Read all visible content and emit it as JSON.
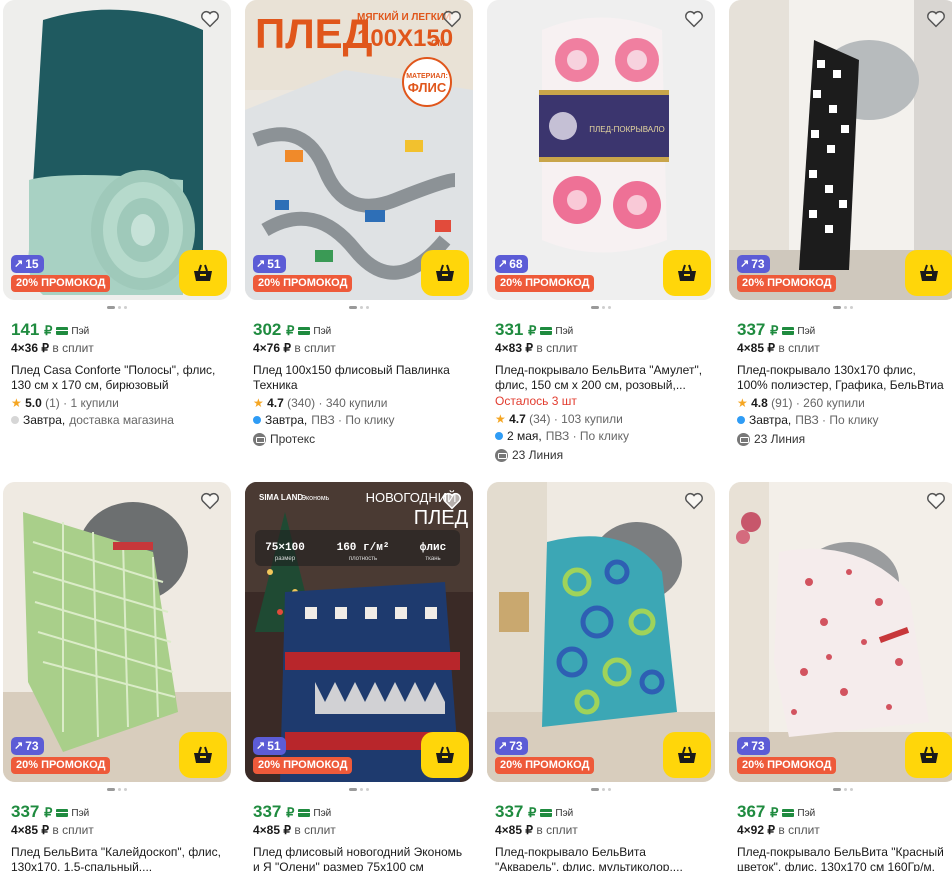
{
  "colors": {
    "price": "#1f8b3f",
    "promo": "#ee5a3a",
    "cashback": "#5c5cd6",
    "cart": "#ffd60a",
    "stock_warning": "#e23b2e"
  },
  "products": [
    {
      "cashback": "15",
      "promo": "20% ПРОМОКОД",
      "price": "141",
      "currency": "₽",
      "pay_label": "Пэй",
      "split_mult": "4×36",
      "split_label": "в сплит",
      "title": "Плед Casa Conforte \"Полосы\", флис, 130 см х 170 см, бирюзовый",
      "rating": "5.0",
      "reviews": "(1)",
      "bought": "· 1 купили",
      "delivery_day": "Завтра,",
      "delivery_rest": "доставка магазина",
      "delivery_dot": "#d6d6d6",
      "seller": ""
    },
    {
      "cashback": "51",
      "promo": "20% ПРОМОКОД",
      "price": "302",
      "currency": "₽",
      "pay_label": "Пэй",
      "split_mult": "4×76",
      "split_label": "в сплит",
      "title": "Плед 100х150 флисовый Павлинка Техника",
      "rating": "4.7",
      "reviews": "(340)",
      "bought": "· 340 купили",
      "delivery_day": "Завтра,",
      "delivery_rest": "ПВЗ · По клику",
      "delivery_dot": "#2f9cf5",
      "seller": "Протекс",
      "overlay": {
        "word": "ПЛЕД",
        "small1": "МЯГКИЙ И ЛЕГКИЙ",
        "size": "100Х150",
        "unit": "СМ",
        "material_label": "МАТЕРИАЛ:",
        "material": "ФЛИС"
      }
    },
    {
      "cashback": "68",
      "promo": "20% ПРОМОКОД",
      "price": "331",
      "currency": "₽",
      "pay_label": "Пэй",
      "split_mult": "4×83",
      "split_label": "в сплит",
      "title": "Плед-покрывало БельВита \"Амулет\", флис, 150 см х 200 см, розовый,...",
      "left": "Осталось 3 шт",
      "rating": "4.7",
      "reviews": "(34)",
      "bought": "· 103 купили",
      "delivery_day": "2 мая,",
      "delivery_rest": "ПВЗ · По клику",
      "delivery_dot": "#2f9cf5",
      "seller": "23 Линия",
      "overlay": {
        "label": "ПЛЕД-ПОКРЫВАЛО"
      }
    },
    {
      "cashback": "73",
      "promo": "20% ПРОМОКОД",
      "price": "337",
      "currency": "₽",
      "pay_label": "Пэй",
      "split_mult": "4×85",
      "split_label": "в сплит",
      "title": "Плед-покрывало 130х170 флис, 100% полиэстер, Графика, БельВтиа",
      "rating": "4.8",
      "reviews": "(91)",
      "bought": "· 260 купили",
      "delivery_day": "Завтра,",
      "delivery_rest": "ПВЗ · По клику",
      "delivery_dot": "#2f9cf5",
      "seller": "23 Линия"
    },
    {
      "cashback": "73",
      "promo": "20% ПРОМОКОД",
      "price": "337",
      "currency": "₽",
      "pay_label": "Пэй",
      "split_mult": "4×85",
      "split_label": "в сплит",
      "title": "Плед БельВита \"Калейдоскоп\", флис, 130х170, 1,5-спальный,..."
    },
    {
      "cashback": "51",
      "promo": "20% ПРОМОКОД",
      "price": "337",
      "currency": "₽",
      "pay_label": "Пэй",
      "split_mult": "4×85",
      "split_label": "в сплит",
      "title": "Плед флисовый новогодний Экономь и Я \"Олени\" размер 75х100 см",
      "overlay": {
        "brand": "SIMA LAND",
        "brand2": "Экономь",
        "head1": "НОВОГОДНИЙ",
        "head2": "ПЛЕД",
        "s1": "75×100",
        "s1l": "размер",
        "s2": "160 г/м²",
        "s2l": "плотность",
        "s3": "флис",
        "s3l": "ткань"
      }
    },
    {
      "cashback": "73",
      "promo": "20% ПРОМОКОД",
      "price": "337",
      "currency": "₽",
      "pay_label": "Пэй",
      "split_mult": "4×85",
      "split_label": "в сплит",
      "title": "Плед-покрывало БельВита \"Акварель\", флис, мультиколор,..."
    },
    {
      "cashback": "73",
      "promo": "20% ПРОМОКОД",
      "price": "367",
      "currency": "₽",
      "pay_label": "Пэй",
      "split_mult": "4×92",
      "split_label": "в сплит",
      "title": "Плед-покрывало БельВита \"Красный цветок\", флис, 130х170 см 160Гр/м. кв"
    }
  ]
}
